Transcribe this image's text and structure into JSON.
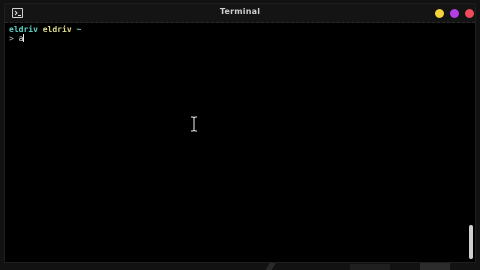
{
  "window": {
    "title": "Terminal",
    "buttons": {
      "minimize_color": "#f5d33b",
      "maximize_color": "#b43ee6",
      "close_color": "#ef4b5c"
    }
  },
  "terminal": {
    "user": "eldriv",
    "host": "eldriv",
    "path": "~",
    "prompt_symbol": ">",
    "current_input": "a"
  },
  "icons": {
    "app_icon": "terminal-icon",
    "mouse_cursor": "ibeam-cursor-icon"
  },
  "scroll_position": 1.0
}
